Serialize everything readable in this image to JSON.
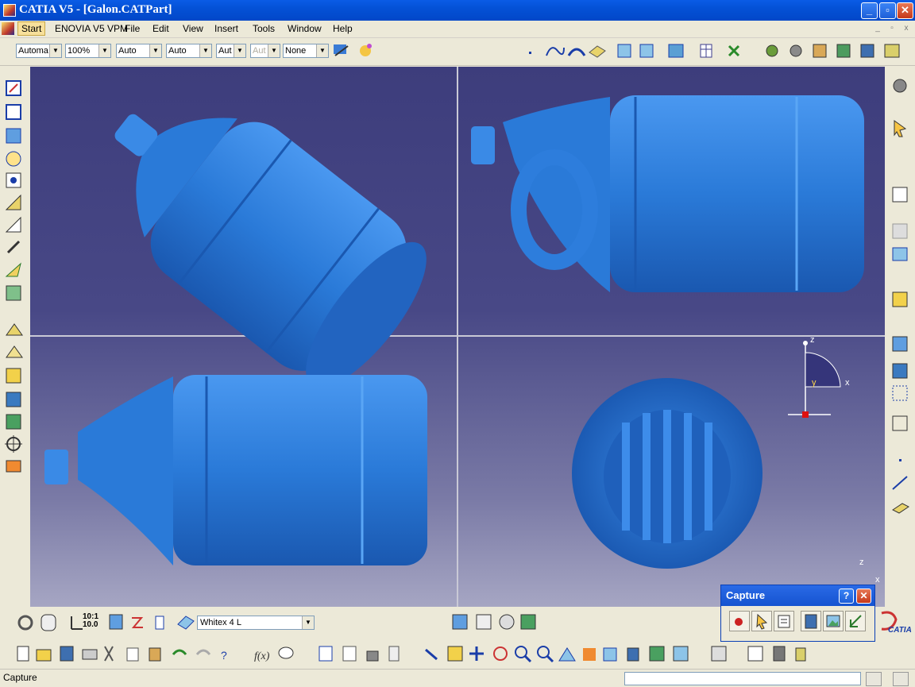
{
  "window": {
    "title": "CATIA V5 - [Galon.CATPart]",
    "minimize": "_",
    "restore": "▫",
    "close": "✕"
  },
  "menu": {
    "items": [
      "Start",
      "ENOVIA V5 VPM",
      "File",
      "Edit",
      "View",
      "Insert",
      "Tools",
      "Window",
      "Help"
    ]
  },
  "toolbar1": {
    "combos": [
      "Automa",
      "100%",
      "Auto",
      "Auto",
      "Aut",
      "Aut",
      "None"
    ]
  },
  "viewport": {
    "compass_labels": {
      "z": "z",
      "x": "x",
      "y": "y"
    },
    "corner_labels": {
      "z": "z",
      "x": "x"
    }
  },
  "bottom": {
    "material_select": "Whitex 4 L"
  },
  "capture": {
    "title": "Capture",
    "help": "?",
    "close": "✕"
  },
  "status": {
    "text": "Capture"
  },
  "colors": {
    "titlebar": "#0451d6",
    "bottle": "#2e7bd8",
    "background_top": "#3d3d7c",
    "background_bottom": "#a6a6c3"
  }
}
